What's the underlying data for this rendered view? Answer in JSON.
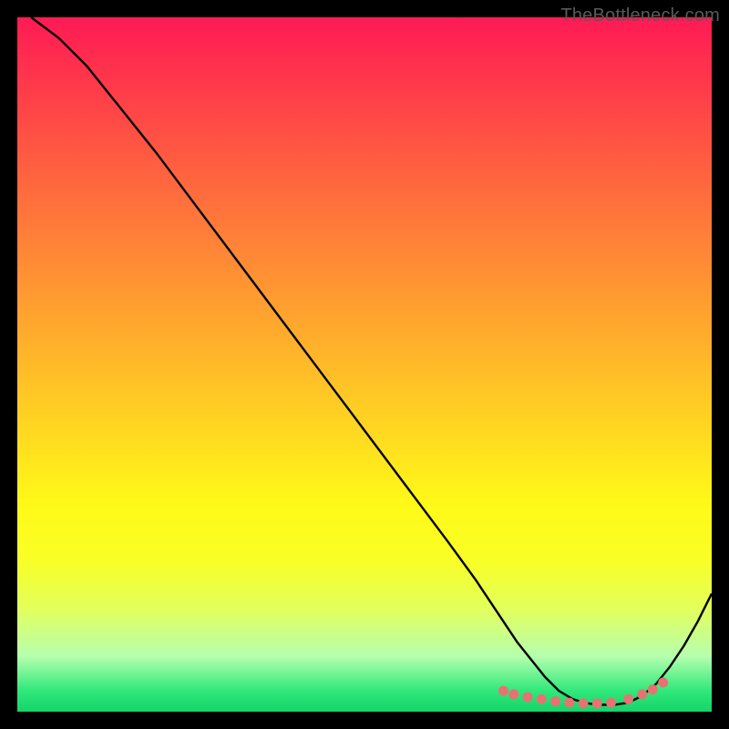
{
  "watermark": "TheBottleneck.com",
  "chart_data": {
    "type": "line",
    "title": "",
    "xlabel": "",
    "ylabel": "",
    "xlim": [
      0,
      100
    ],
    "ylim": [
      0,
      100
    ],
    "series": [
      {
        "name": "curve",
        "x": [
          2,
          6,
          10,
          14,
          20,
          26,
          32,
          38,
          44,
          50,
          56,
          62,
          66,
          70,
          72,
          74,
          76,
          78,
          80,
          82,
          84,
          86,
          88,
          90,
          92,
          94,
          96,
          98,
          100
        ],
        "y": [
          100,
          97,
          93,
          88,
          80.5,
          72.5,
          64.5,
          56.5,
          48.5,
          40.5,
          32.5,
          24.5,
          19,
          13,
          10,
          7.5,
          5,
          3,
          1.8,
          1.2,
          1,
          1,
          1.3,
          2.3,
          4,
          6.5,
          9.5,
          13,
          17
        ]
      }
    ],
    "markers": {
      "name": "highlight-points",
      "color": "#e77272",
      "x": [
        70,
        71.5,
        73.5,
        75.5,
        77.5,
        79.5,
        81.5,
        83.5,
        85.5,
        88,
        90,
        91.5,
        93
      ],
      "y": [
        3,
        2.5,
        2.1,
        1.8,
        1.5,
        1.3,
        1.2,
        1.2,
        1.3,
        1.8,
        2.5,
        3.2,
        4.2
      ]
    },
    "gradient_stops": [
      {
        "pos": 0,
        "color": "#ff1a55"
      },
      {
        "pos": 100,
        "color": "#14d468"
      }
    ]
  }
}
